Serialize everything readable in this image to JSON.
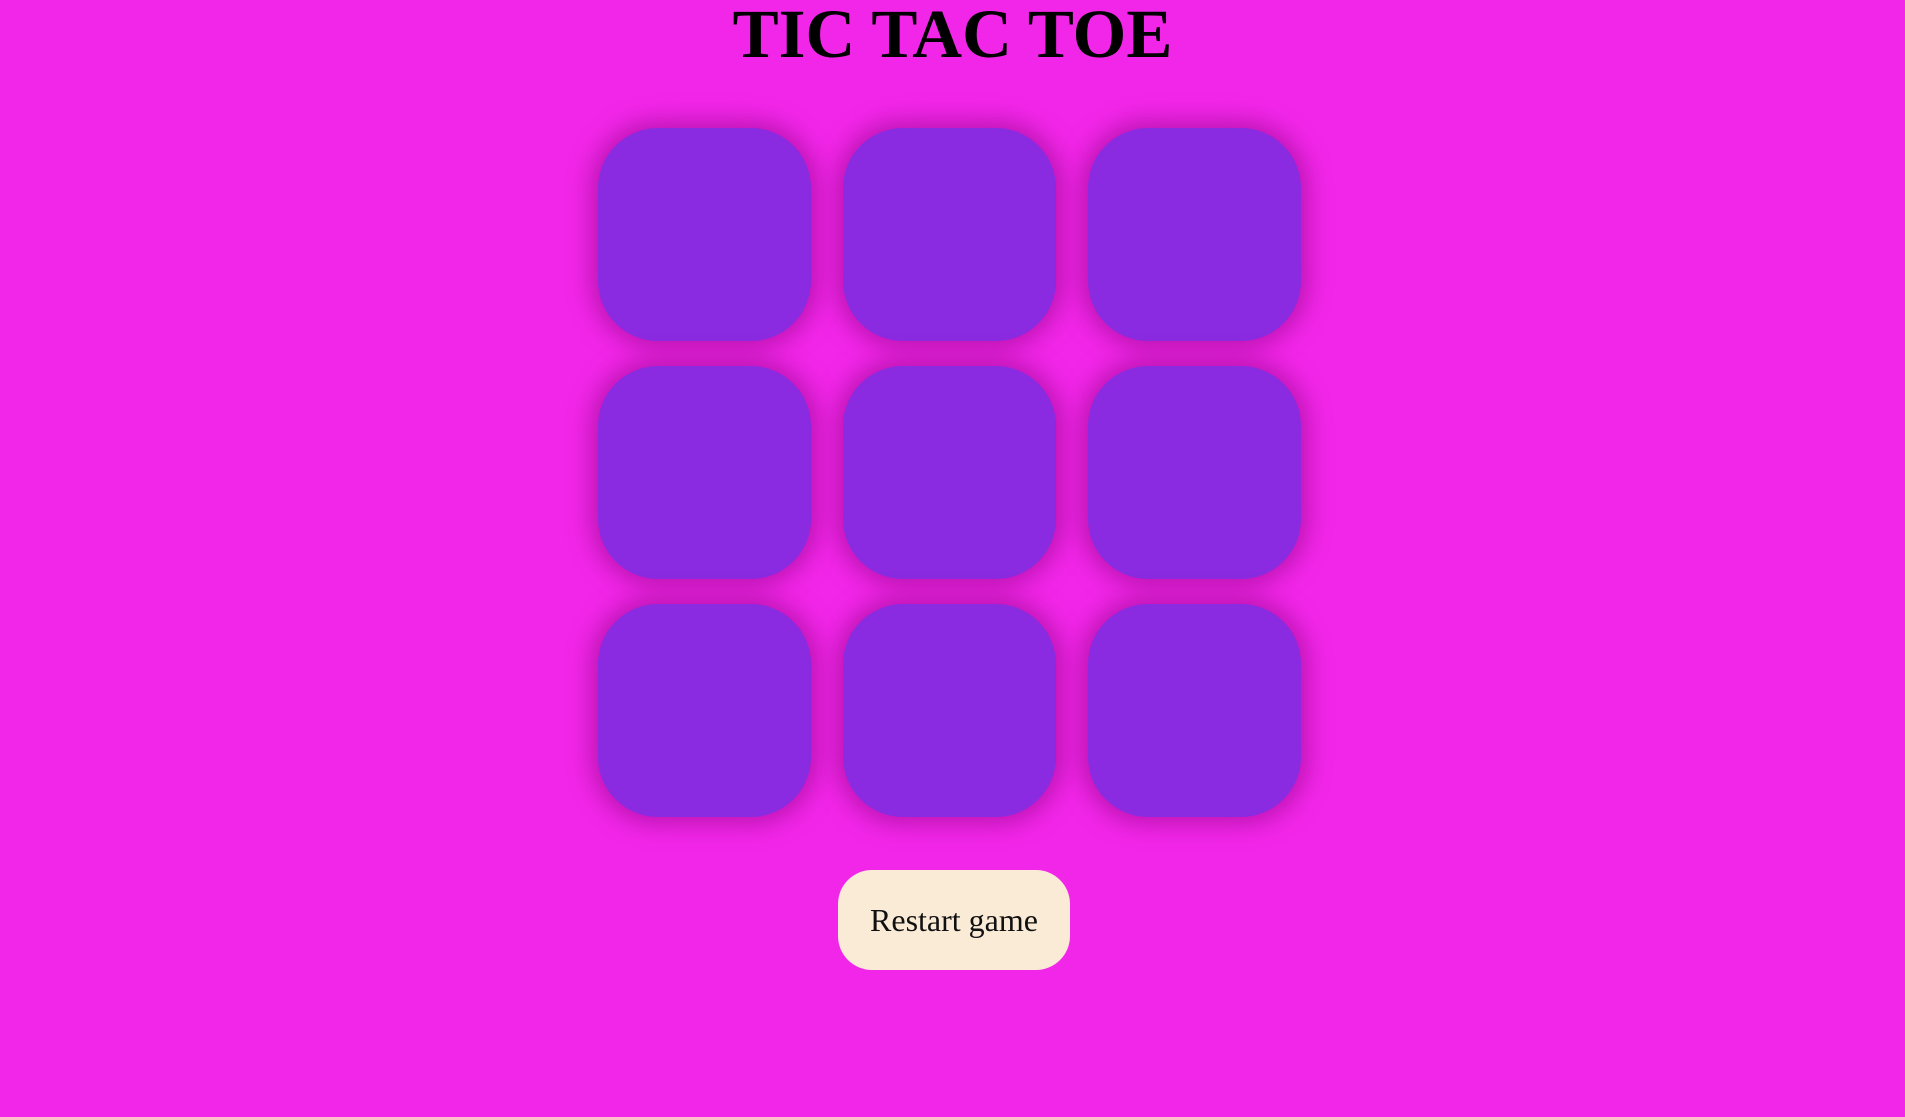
{
  "page": {
    "title": "TIC TAC TOE",
    "background_color": "#f226e8"
  },
  "board": {
    "cell_color": "#8a2be2",
    "cells": [
      "",
      "",
      "",
      "",
      "",
      "",
      "",
      "",
      ""
    ]
  },
  "controls": {
    "restart_label": "Restart game",
    "restart_color": "#faebd7"
  }
}
